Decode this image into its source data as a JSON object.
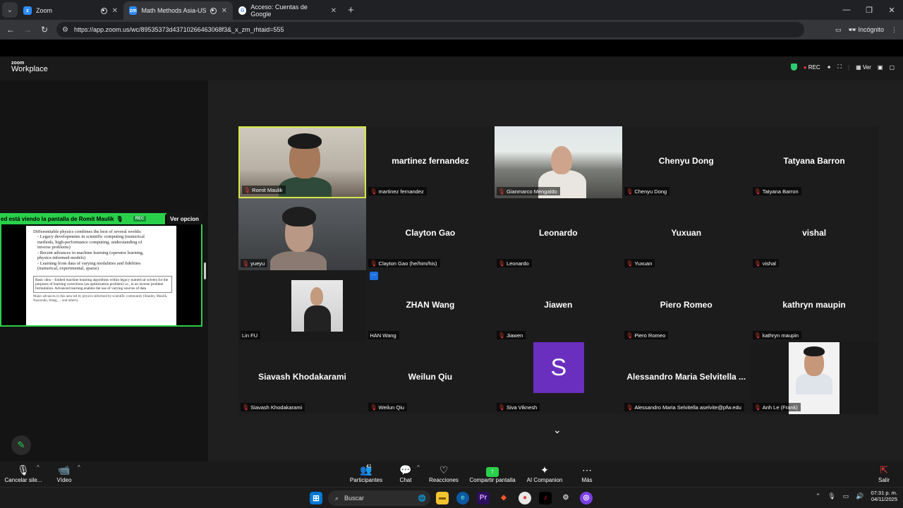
{
  "browser": {
    "tabs": [
      {
        "title": "Zoom",
        "active": false
      },
      {
        "title": "Math Methods Asia-USA Se",
        "active": true
      },
      {
        "title": "Acceso: Cuentas de Google",
        "active": false
      }
    ],
    "url": "https://app.zoom.us/wc/89535373d43710266463068f3&_x_zm_rhtaid=555",
    "incognito_label": "Incógnito"
  },
  "zoom": {
    "logo_small": "zoom",
    "logo_big": "Workplace",
    "rec_label": "REC",
    "view_label": "Ver"
  },
  "share": {
    "banner": "ed está viendo la pantalla de  Romit Maulik",
    "rec": "REC",
    "options_button": "Ver opcion",
    "slide_lines": [
      "Differentiable physics combines the best of several worlds:",
      "- Legacy developments in scientific computing (numerical",
      "  methods, high-performance computing, understanding of",
      "  inverse problems)",
      "- Recent advances in machine learning (operator learning,",
      "  physics-informed models)",
      "- Learning from data of varying modalities and fidelities",
      "  (numerical, experimental, sparse)"
    ],
    "slide_box": "Basic idea – Embed machine learning algorithms within legacy numerical solvers for the purposes of learning corrections (an optimization problem) i.e., in an inverse problem formulation. Advanced learning enables the use of varying sources of data",
    "slide_foot": "Major advances in this area led by physics-informed by scientific community (Stanley, Maulik, Nascendo, Wang, ... and others)"
  },
  "participants": [
    {
      "name": "",
      "label": "Romit Maulik",
      "video": "romit"
    },
    {
      "name": "martinez fernandez",
      "label": "martinez fernandez",
      "video": ""
    },
    {
      "name": "",
      "label": "Gianmarco Mengaldo",
      "video": "gianmarco"
    },
    {
      "name": "Chenyu Dong",
      "label": "Chenyu Dong",
      "video": ""
    },
    {
      "name": "Tatyana Barron",
      "label": "Tatyana Barron",
      "video": ""
    },
    {
      "name": "",
      "label": "yueyu",
      "video": "yueyu"
    },
    {
      "name": "Clayton Gao",
      "label": "Clayton Gao (he/him/his)",
      "video": ""
    },
    {
      "name": "Leonardo",
      "label": "Leonardo",
      "video": ""
    },
    {
      "name": "Yuxuan",
      "label": "Yuxuan",
      "video": ""
    },
    {
      "name": "vishal",
      "label": "vishal",
      "video": ""
    },
    {
      "name": "",
      "label": "Lin FU",
      "video": "linfu"
    },
    {
      "name": "ZHAN Wang",
      "label": "HAN Wang",
      "video": ""
    },
    {
      "name": "Jiawen",
      "label": "Jiawen",
      "video": ""
    },
    {
      "name": "Piero Romeo",
      "label": "Piero Romeo",
      "video": ""
    },
    {
      "name": "kathryn maupin",
      "label": "kathryn maupin",
      "video": ""
    },
    {
      "name": "Siavash Khodakarami",
      "label": "Siavash Khodakarami",
      "video": ""
    },
    {
      "name": "Weilun Qiu",
      "label": "Weilun Qiu",
      "video": ""
    },
    {
      "name": "",
      "label": "Siva Viknesh",
      "video": "avatar",
      "avatar_letter": "S"
    },
    {
      "name": "Alessandro Maria Selvitella ...",
      "label": "Alessandro Maria Selvitella aselvite@pfw.edu",
      "video": ""
    },
    {
      "name": "",
      "label": "Anh Le (Frank)",
      "video": "anh"
    }
  ],
  "toolbar": {
    "mute": "Cancelar sile...",
    "video": "Vídeo",
    "participants": "Participantes",
    "participant_count": "41",
    "chat": "Chat",
    "reactions": "Reacciones",
    "share": "Compartir pantalla",
    "ai": "AI Companion",
    "more": "Más",
    "leave": "Salir"
  },
  "taskbar": {
    "search_placeholder": "Buscar",
    "time": "07:31 p. m.",
    "date": "04/11/2025"
  },
  "colors": {
    "share_green": "#29d14a",
    "active_speaker": "#d6e94a",
    "avatar_purple": "#6b2fbf",
    "muted_red": "#e53935"
  }
}
